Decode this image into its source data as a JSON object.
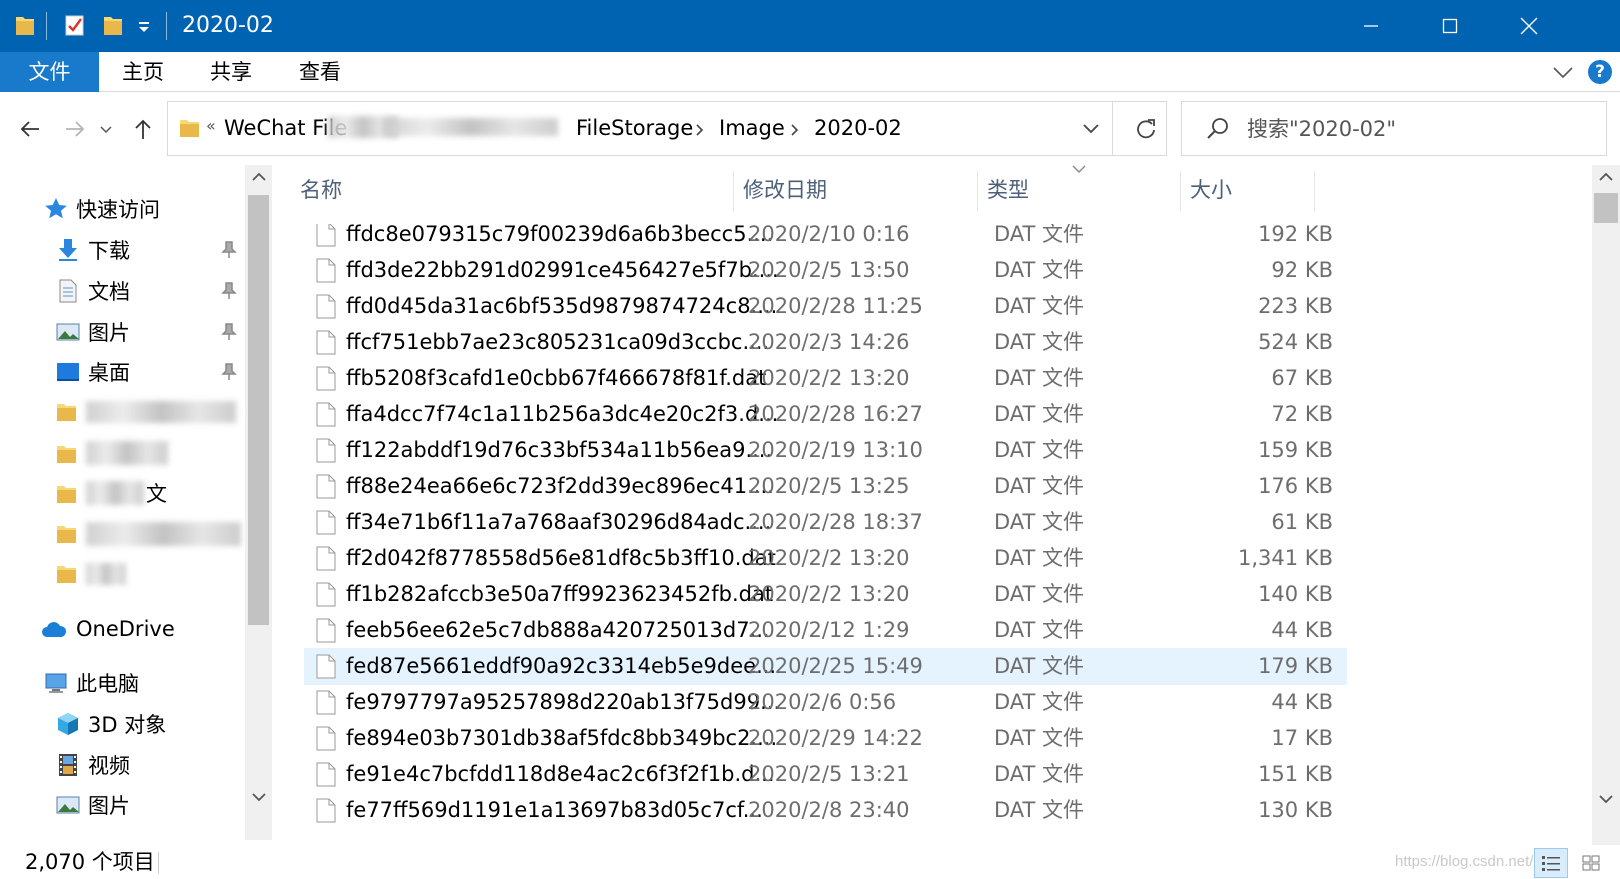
{
  "window": {
    "title": "2020-02"
  },
  "ribbon": {
    "tabs": [
      "文件",
      "主页",
      "共享",
      "查看"
    ],
    "help": "?"
  },
  "address": {
    "crumbs": [
      "WeChat File",
      "FileStorage",
      "Image",
      "2020-02"
    ],
    "overflow": "«"
  },
  "search": {
    "placeholder": "搜索\"2020-02\""
  },
  "nav": {
    "quick_access": "快速访问",
    "pinned": [
      "下载",
      "文档",
      "图片",
      "桌面"
    ],
    "partial_item_text": "文",
    "onedrive": "OneDrive",
    "this_pc": "此电脑",
    "pc_items": [
      "3D 对象",
      "视频",
      "图片"
    ]
  },
  "columns": {
    "name": "名称",
    "date": "修改日期",
    "type": "类型",
    "size": "大小"
  },
  "files": [
    {
      "name": "ffdc8e079315c79f00239d6a6b3becc5....",
      "date": "2020/2/10 0:16",
      "type": "DAT 文件",
      "size": "192 KB"
    },
    {
      "name": "ffd3de22bb291d02991ce456427e5f7b....",
      "date": "2020/2/5 13:50",
      "type": "DAT 文件",
      "size": "92 KB"
    },
    {
      "name": "ffd0d45da31ac6bf535d9879874724c8....",
      "date": "2020/2/28 11:25",
      "type": "DAT 文件",
      "size": "223 KB"
    },
    {
      "name": "ffcf751ebb7ae23c805231ca09d3ccbc....",
      "date": "2020/2/3 14:26",
      "type": "DAT 文件",
      "size": "524 KB"
    },
    {
      "name": "ffb5208f3cafd1e0cbb67f466678f81f.dat",
      "date": "2020/2/2 13:20",
      "type": "DAT 文件",
      "size": "67 KB"
    },
    {
      "name": "ffa4dcc7f74c1a11b256a3dc4e20c2f3.d...",
      "date": "2020/2/28 16:27",
      "type": "DAT 文件",
      "size": "72 KB"
    },
    {
      "name": "ff122abddf19d76c33bf534a11b56ea9....",
      "date": "2020/2/19 13:10",
      "type": "DAT 文件",
      "size": "159 KB"
    },
    {
      "name": "ff88e24ea66e6c723f2dd39ec896ec41....",
      "date": "2020/2/5 13:25",
      "type": "DAT 文件",
      "size": "176 KB"
    },
    {
      "name": "ff34e71b6f11a7a768aaf30296d84adc....",
      "date": "2020/2/28 18:37",
      "type": "DAT 文件",
      "size": "61 KB"
    },
    {
      "name": "ff2d042f8778558d56e81df8c5b3ff10.dat",
      "date": "2020/2/2 13:20",
      "type": "DAT 文件",
      "size": "1,341 KB"
    },
    {
      "name": "ff1b282afccb3e50a7ff9923623452fb.dat",
      "date": "2020/2/2 13:20",
      "type": "DAT 文件",
      "size": "140 KB"
    },
    {
      "name": "feeb56ee62e5c7db888a420725013d7...",
      "date": "2020/2/12 1:29",
      "type": "DAT 文件",
      "size": "44 KB"
    },
    {
      "name": "fed87e5661eddf90a92c3314eb5e9dee...",
      "date": "2020/2/25 15:49",
      "type": "DAT 文件",
      "size": "179 KB",
      "selected": true
    },
    {
      "name": "fe9797797a95257898d220ab13f75d99...",
      "date": "2020/2/6 0:56",
      "type": "DAT 文件",
      "size": "44 KB"
    },
    {
      "name": "fe894e03b7301db38af5fdc8bb349bc2....",
      "date": "2020/2/29 14:22",
      "type": "DAT 文件",
      "size": "17 KB"
    },
    {
      "name": "fe91e4c7bcfdd118d8e4ac2c6f3f2f1b.d...",
      "date": "2020/2/5 13:21",
      "type": "DAT 文件",
      "size": "151 KB"
    },
    {
      "name": "fe77ff569d1191e1a13697b83d05c7cf...",
      "date": "2020/2/8 23:40",
      "type": "DAT 文件",
      "size": "130 KB"
    }
  ],
  "status": {
    "item_count": "2,070 个项目",
    "watermark": "https://blog.csdn.net/..."
  },
  "colors": {
    "titlebar": "#0063b1",
    "file_tab": "#1979ca",
    "selected_row": "#e5f3ff",
    "header_text": "#4c607a"
  }
}
